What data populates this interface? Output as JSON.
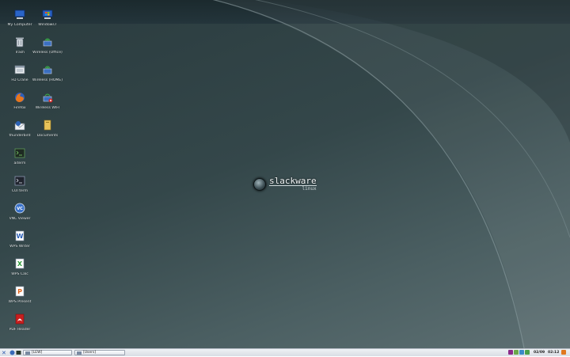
{
  "desktop": {
    "logo": {
      "brand": "slackware",
      "subtitle": "linux"
    },
    "icons": [
      {
        "label": "My Computer",
        "icon": "computer-icon"
      },
      {
        "label": "Trash",
        "icon": "trash-icon"
      },
      {
        "label": "FD Crane",
        "icon": "window-icon"
      },
      {
        "label": "Firefox",
        "icon": "firefox-icon"
      },
      {
        "label": "thunderbird",
        "icon": "thunderbird-icon"
      },
      {
        "label": "aiterm",
        "icon": "terminal-icon"
      },
      {
        "label": "CUI term",
        "icon": "terminal-icon"
      },
      {
        "label": "VNC Viewer",
        "icon": "vnc-icon"
      },
      {
        "label": "WPS Writer",
        "icon": "writer-icon"
      },
      {
        "label": "WPS Calc",
        "icon": "spreadsheet-icon"
      },
      {
        "label": "WPS Present",
        "icon": "presentation-icon"
      },
      {
        "label": "PDF Reader",
        "icon": "pdf-icon"
      },
      {
        "label": "Windows7",
        "icon": "windows-icon"
      },
      {
        "label": "Wireless (Office)",
        "icon": "wireless-icon"
      },
      {
        "label": "Wireless (HOME)",
        "icon": "wireless-icon"
      },
      {
        "label": "Wireless WIFI",
        "icon": "wireless-disconnected-icon"
      },
      {
        "label": "Documents",
        "icon": "folder-icon"
      }
    ]
  },
  "taskbar": {
    "tasks": [
      {
        "label": "[LEW]"
      },
      {
        "label": "[Users]"
      }
    ],
    "clock": {
      "date": "02/09",
      "time": "02:12"
    },
    "colors": {
      "accent": "#2a58b0",
      "tray_warn": "#e07820"
    }
  }
}
